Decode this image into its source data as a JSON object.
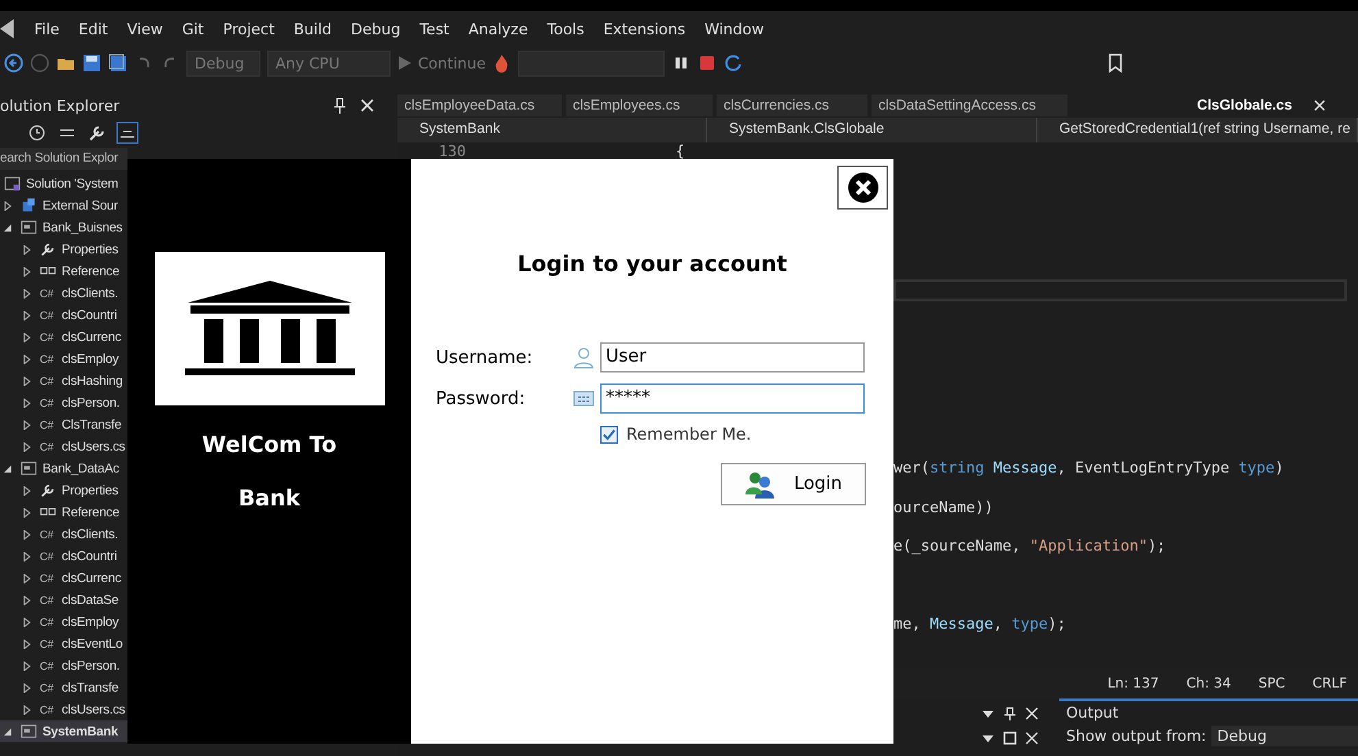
{
  "menu": [
    "File",
    "Edit",
    "View",
    "Git",
    "Project",
    "Build",
    "Debug",
    "Test",
    "Analyze",
    "Tools",
    "Extensions",
    "Window"
  ],
  "toolbar": {
    "configuration": "Debug",
    "platform": "Any CPU",
    "continue": "Continue"
  },
  "solution_explorer": {
    "title": "olution Explorer",
    "search_placeholder": "earch Solution Explor",
    "tree": [
      {
        "label": "Solution 'System",
        "kind": "solution",
        "selected": false,
        "children": [
          {
            "label": "External Sour",
            "kind": "external",
            "expanded": false,
            "selected": false
          },
          {
            "label": "Bank_Buisnes",
            "kind": "project",
            "expanded": true,
            "selected": false,
            "children": [
              {
                "label": "Properties",
                "kind": "properties",
                "expanded": false,
                "selected": false
              },
              {
                "label": "Reference",
                "kind": "references",
                "expanded": false,
                "selected": false
              },
              {
                "label": "clsClients.",
                "kind": "cs",
                "icon_text": "C#",
                "expanded": false,
                "selected": false
              },
              {
                "label": "clsCountri",
                "kind": "cs",
                "icon_text": "C#",
                "expanded": false,
                "selected": false
              },
              {
                "label": "clsCurrenc",
                "kind": "cs",
                "icon_text": "C#",
                "expanded": false,
                "selected": false
              },
              {
                "label": "clsEmploy",
                "kind": "cs",
                "icon_text": "C#",
                "expanded": false,
                "selected": false
              },
              {
                "label": "clsHashing",
                "kind": "cs",
                "icon_text": "C#",
                "expanded": false,
                "selected": false
              },
              {
                "label": "clsPerson.",
                "kind": "cs",
                "icon_text": "C#",
                "expanded": false,
                "selected": false
              },
              {
                "label": "ClsTransfe",
                "kind": "cs",
                "icon_text": "C#",
                "expanded": false,
                "selected": false
              },
              {
                "label": "clsUsers.cs",
                "kind": "cs",
                "icon_text": "C#",
                "expanded": false,
                "selected": false
              }
            ]
          },
          {
            "label": "Bank_DataAc",
            "kind": "project",
            "expanded": true,
            "selected": false,
            "children": [
              {
                "label": "Properties",
                "kind": "properties",
                "expanded": false,
                "selected": false
              },
              {
                "label": "Reference",
                "kind": "references",
                "expanded": false,
                "selected": false
              },
              {
                "label": "clsClients.",
                "kind": "cs",
                "icon_text": "C#",
                "expanded": false,
                "selected": false
              },
              {
                "label": "clsCountri",
                "kind": "cs",
                "icon_text": "C#",
                "expanded": false,
                "selected": false
              },
              {
                "label": "clsCurrenc",
                "kind": "cs",
                "icon_text": "C#",
                "expanded": false,
                "selected": false
              },
              {
                "label": "clsDataSe",
                "kind": "cs",
                "icon_text": "C#",
                "expanded": false,
                "selected": false
              },
              {
                "label": "clsEmploy",
                "kind": "cs",
                "icon_text": "C#",
                "expanded": false,
                "selected": false
              },
              {
                "label": "clsEventLo",
                "kind": "cs",
                "icon_text": "C#",
                "expanded": false,
                "selected": false
              },
              {
                "label": "clsPerson.",
                "kind": "cs",
                "icon_text": "C#",
                "expanded": false,
                "selected": false
              },
              {
                "label": "clsTransfe",
                "kind": "cs",
                "icon_text": "C#",
                "expanded": false,
                "selected": false
              },
              {
                "label": "clsUsers.cs",
                "kind": "cs",
                "icon_text": "C#",
                "expanded": false,
                "selected": false
              }
            ]
          },
          {
            "label": "SystemBank",
            "kind": "project",
            "expanded": true,
            "selected": true
          }
        ]
      }
    ]
  },
  "editor": {
    "tabs": [
      {
        "label": "clsEmployeeData.cs",
        "selected": false
      },
      {
        "label": "clsEmployees.cs",
        "selected": false
      },
      {
        "label": "clsCurrencies.cs",
        "selected": false
      },
      {
        "label": "clsDataSettingAccess.cs",
        "selected": false
      },
      {
        "label": "ClsGlobale.cs",
        "selected": true
      }
    ],
    "nav": [
      "SystemBank",
      "SystemBank.ClsGlobale",
      "GetStoredCredential1(ref string Username, re"
    ],
    "lines": [
      {
        "number": "130",
        "segments": [
          {
            "text": "{",
            "kind": "plain"
          }
        ]
      },
      {
        "segments": [
          {
            "text": "wer(",
            "kind": "plain"
          },
          {
            "text": "string",
            "kind": "keyword"
          },
          {
            "text": " Message",
            "kind": "param"
          },
          {
            "text": ", EventLogEntryType ",
            "kind": "plain"
          },
          {
            "text": "type",
            "kind": "keyword"
          },
          {
            "text": ")",
            "kind": "plain"
          }
        ]
      },
      {
        "segments": [
          {
            "text": "ourceName))",
            "kind": "plain"
          }
        ]
      },
      {
        "segments": [
          {
            "text": "e(_sourceName, ",
            "kind": "plain"
          },
          {
            "text": "\"Application\"",
            "kind": "string"
          },
          {
            "text": ");",
            "kind": "plain"
          }
        ]
      },
      {
        "segments": [
          {
            "text": "me, ",
            "kind": "plain"
          },
          {
            "text": "Message",
            "kind": "param"
          },
          {
            "text": ", ",
            "kind": "plain"
          },
          {
            "text": "type",
            "kind": "keyword"
          },
          {
            "text": ");",
            "kind": "plain"
          }
        ]
      }
    ],
    "status": [
      "Ln: 137",
      "Ch: 34",
      "SPC",
      "CRLF"
    ]
  },
  "output": {
    "title": "Output",
    "source_label": "Show output from:",
    "source": "Debug"
  },
  "login": {
    "welcome": "WelCom To",
    "bank": "Bank",
    "title": "Login to your account",
    "username_label": "Username:",
    "username": "User",
    "password_label": "Password:",
    "password": "*****",
    "remember": {
      "label": "Remember Me.",
      "checked": true
    },
    "button": "Login"
  }
}
